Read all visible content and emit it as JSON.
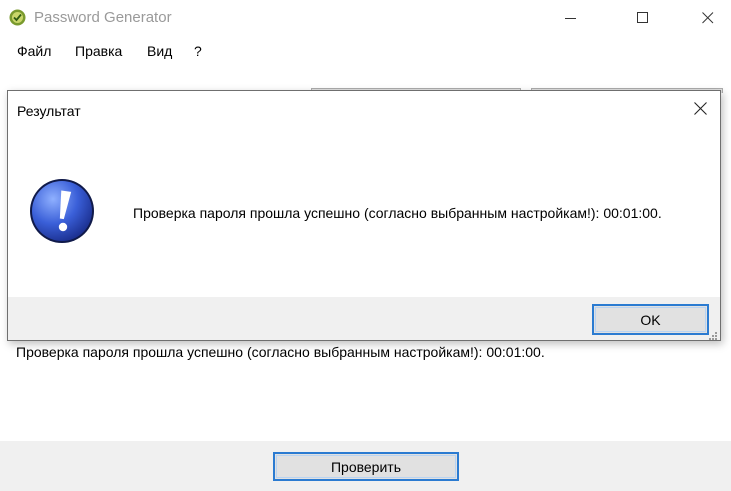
{
  "window": {
    "title": "Password Generator",
    "icon": "password-generator-app-icon",
    "controls": [
      "minimize-icon",
      "maximize-icon",
      "close-icon"
    ]
  },
  "menu": {
    "items": [
      {
        "label": "Файл"
      },
      {
        "label": "Правка"
      },
      {
        "label": "Вид"
      },
      {
        "label": "?"
      }
    ]
  },
  "main": {
    "result_text": "Проверка пароля прошла успешно (согласно выбранным настройкам!): 00:01:00.",
    "check_button_label": "Проверить"
  },
  "dialog": {
    "title": "Результат",
    "icon": "exclamation-info-icon",
    "message": "Проверка пароля прошла успешно (согласно выбранным настройкам!): 00:01:00.",
    "ok_label": "OK"
  },
  "colors": {
    "focus_border": "#2b7bd1",
    "button_face": "#e1e1e1",
    "footer_bg": "#f0f0f0",
    "icon_blue": "#3a5fd8"
  }
}
